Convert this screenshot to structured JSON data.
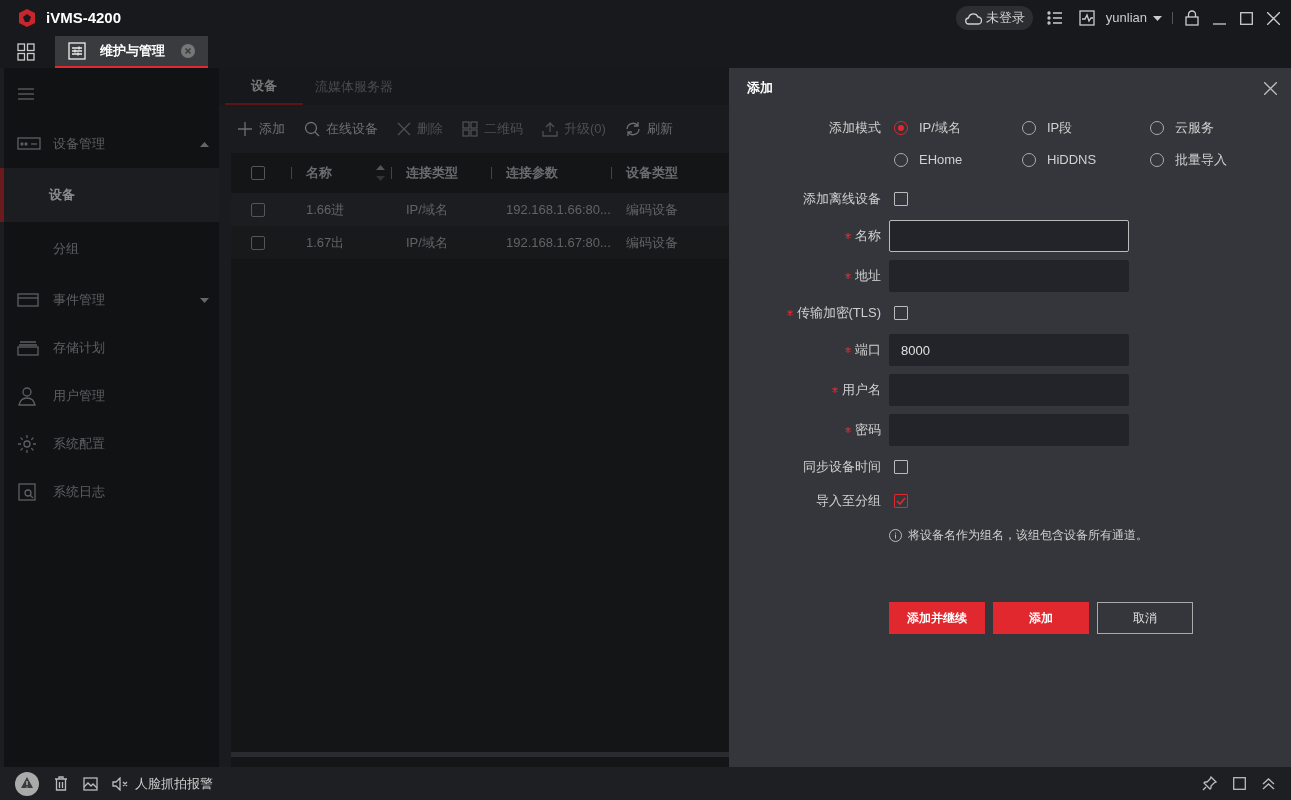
{
  "app": {
    "title": "iVMS-4200"
  },
  "header": {
    "login": "未登录",
    "user": "yunlian"
  },
  "tabs": [
    {
      "label": "维护与管理",
      "selected": true
    }
  ],
  "sidebar": {
    "items": [
      {
        "label": "设备管理",
        "kind": "device",
        "expanded": true,
        "children": [
          {
            "label": "设备",
            "selected": true
          },
          {
            "label": "分组",
            "selected": false
          }
        ]
      },
      {
        "label": "事件管理",
        "kind": "event",
        "expanded": false
      },
      {
        "label": "存储计划",
        "kind": "storage"
      },
      {
        "label": "用户管理",
        "kind": "user"
      },
      {
        "label": "系统配置",
        "kind": "config"
      },
      {
        "label": "系统日志",
        "kind": "log"
      }
    ]
  },
  "content_tabs": [
    {
      "label": "设备",
      "selected": true
    },
    {
      "label": "流媒体服务器",
      "selected": false
    }
  ],
  "toolbar": [
    {
      "label": "添加",
      "kind": "add",
      "disabled": false
    },
    {
      "label": "在线设备",
      "kind": "search",
      "disabled": false
    },
    {
      "label": "删除",
      "kind": "delete",
      "disabled": true
    },
    {
      "label": "二维码",
      "kind": "qr",
      "disabled": true
    },
    {
      "label": "升级(0)",
      "kind": "upgrade",
      "disabled": true
    },
    {
      "label": "刷新",
      "kind": "refresh",
      "disabled": false
    }
  ],
  "table": {
    "select_all": false,
    "columns": [
      "名称",
      "连接类型",
      "连接参数",
      "设备类型"
    ],
    "rows": [
      {
        "checked": false,
        "cells": [
          "1.66进",
          "IP/域名",
          "192.168.1.66:80...",
          "编码设备"
        ]
      },
      {
        "checked": false,
        "cells": [
          "1.67出",
          "IP/域名",
          "192.168.1.67:80...",
          "编码设备"
        ]
      }
    ]
  },
  "dialog": {
    "title": "添加",
    "mode_label": "添加模式",
    "modes": [
      {
        "label": "IP/域名",
        "selected": true
      },
      {
        "label": "IP段",
        "selected": false
      },
      {
        "label": "云服务",
        "selected": false
      },
      {
        "label": "EHome",
        "selected": false
      },
      {
        "label": "HiDDNS",
        "selected": false
      },
      {
        "label": "批量导入",
        "selected": false
      }
    ],
    "fields": [
      {
        "label": "添加离线设备",
        "kind": "checkbox",
        "required": false,
        "checked": false
      },
      {
        "label": "名称",
        "kind": "text",
        "required": true,
        "focused": true
      },
      {
        "label": "地址",
        "kind": "text",
        "required": true,
        "focused": false
      },
      {
        "label": "传输加密(TLS)",
        "kind": "checkbox",
        "required": true,
        "checked": false
      },
      {
        "label": "端口",
        "kind": "text",
        "required": true,
        "focused": false,
        "value": "8000"
      },
      {
        "label": "用户名",
        "kind": "text",
        "required": true,
        "focused": false
      },
      {
        "label": "密码",
        "kind": "text",
        "required": true,
        "focused": false
      },
      {
        "label": "同步设备时间",
        "kind": "checkbox",
        "required": false,
        "checked": false
      },
      {
        "label": "导入至分组",
        "kind": "checkbox",
        "required": false,
        "checked": true
      }
    ],
    "hint": "将设备名作为组名，该组包含设备所有通道。",
    "buttons": [
      {
        "label": "添加并继续",
        "kind": "primary"
      },
      {
        "label": "添加",
        "kind": "primary"
      },
      {
        "label": "取消",
        "kind": "secondary"
      }
    ]
  },
  "status_bar": {
    "alarm": "人脸抓拍报警"
  }
}
